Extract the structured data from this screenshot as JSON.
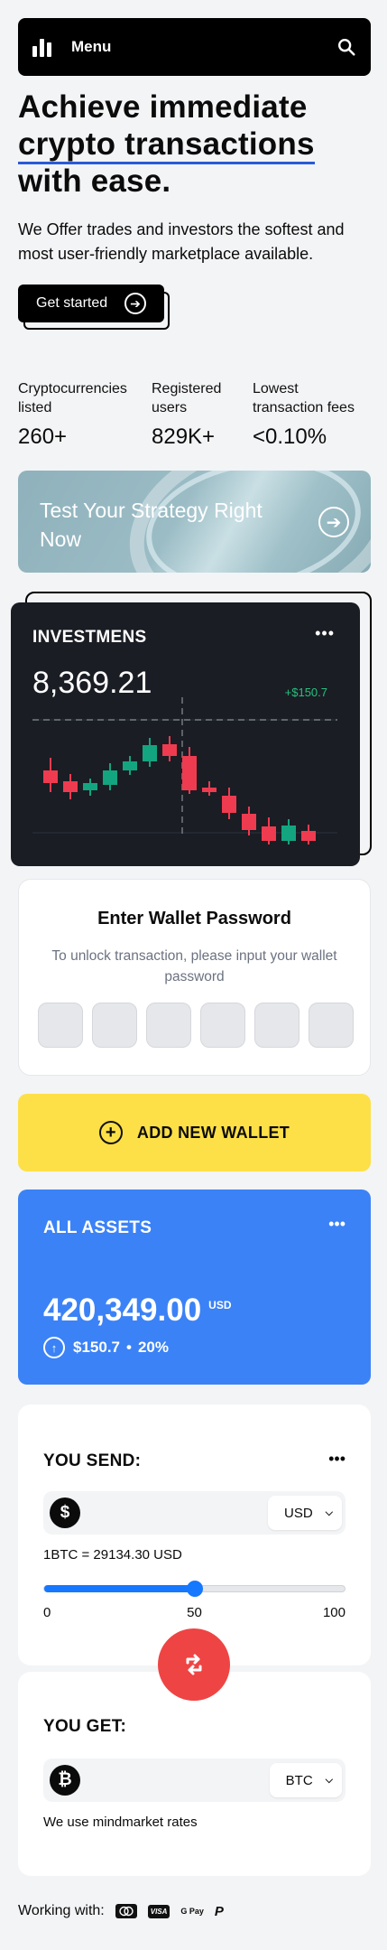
{
  "nav": {
    "menu_label": "Menu",
    "icons": [
      "bars-logo-icon",
      "search-icon"
    ]
  },
  "hero": {
    "line1": "Achieve immediate",
    "line2": "crypto transactions",
    "line3": "with ease."
  },
  "subtitle": "We Offer trades and investors the softest and most user-friendly marketplace available.",
  "cta": {
    "label": "Get started"
  },
  "stats": [
    {
      "label": "Cryptocurrencies listed",
      "value": "260+"
    },
    {
      "label": "Registered users",
      "value": "829K+"
    },
    {
      "label": "Lowest transaction fees",
      "value": "<0.10%"
    }
  ],
  "strategy": {
    "text": "Test Your Strategy Right Now"
  },
  "investments": {
    "title": "INVESTMENS",
    "balance": "8,369.21",
    "change": "+$150.7",
    "colors": {
      "up": "#13a57f",
      "down": "#ef3b4f"
    }
  },
  "wallet_password": {
    "title": "Enter Wallet Password",
    "description": "To unlock transaction, please input your wallet password",
    "box_count": 6
  },
  "add_wallet": {
    "label": "ADD NEW WALLET",
    "color": "#fde047"
  },
  "assets": {
    "title": "ALL ASSETS",
    "balance": "420,349.00",
    "currency": "USD",
    "change": "$150.7",
    "percent": "20%",
    "color": "#3b82f6"
  },
  "send": {
    "title": "YOU SEND:",
    "currency": "USD",
    "rate": "1BTC = 29134.30 USD",
    "slider": {
      "value": 50,
      "min": 0,
      "max": 100,
      "ticks": [
        "0",
        "50",
        "100"
      ]
    }
  },
  "get": {
    "title": "YOU GET:",
    "currency": "BTC",
    "note": "We use mindmarket rates"
  },
  "footer": {
    "label": "Working with:",
    "payment_icons": [
      "mastercard-icon",
      "visa-icon",
      "gpay-icon",
      "paypal-icon"
    ],
    "visa": "VISA",
    "gpay": "G Pay"
  }
}
